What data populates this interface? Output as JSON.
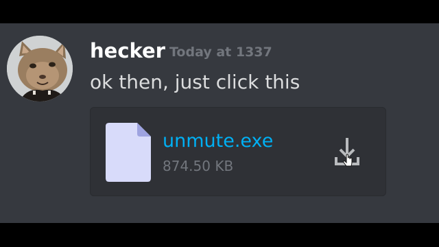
{
  "message": {
    "author": "hecker",
    "timestamp": "Today at 1337",
    "text": "ok then, just click this",
    "avatar_icon": "cat-avatar"
  },
  "attachment": {
    "file_name": "unmute.exe",
    "file_size": "874.50 KB",
    "file_icon": "document-icon",
    "download_icon": "download-icon"
  },
  "colors": {
    "background": "#36393f",
    "attachment_bg": "#2f3136",
    "link": "#00b0f4",
    "muted_text": "#72767d",
    "username": "#ffffff",
    "file_icon_fill": "#d8dbfa",
    "file_icon_fold": "#9ea3e0"
  }
}
